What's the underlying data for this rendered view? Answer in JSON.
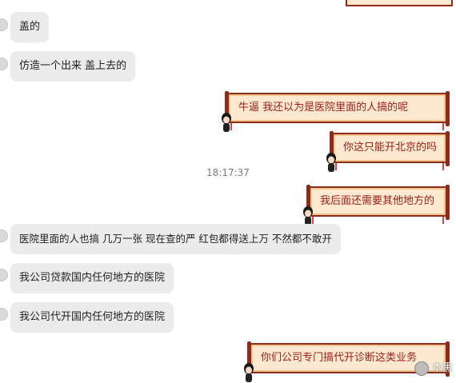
{
  "messages": {
    "m1": "盖的",
    "m2": "仿造一个出来 盖上去的",
    "m3": "牛逼   我还以为是医院里面的人搞的呢",
    "m4": "你这只能开北京的吗",
    "time": "18:17:37",
    "m5": "我后面还需要其他地方的",
    "m6": "医院里面的人也搞  几万一张  现在查的严  红包都得送上万  不然都不敢开",
    "m7": "我公司贷款国内任何地方的医院",
    "m8": "我公司代开国内任何地方的医院",
    "m9": "你们公司专门搞代开诊断这类业务"
  },
  "watermark": "本黑",
  "colors": {
    "left_bubble": "#ebebeb",
    "right_bubble_bg": "#fde9cf",
    "right_bubble_border": "#8c2a1c",
    "right_text": "#a0201a"
  }
}
